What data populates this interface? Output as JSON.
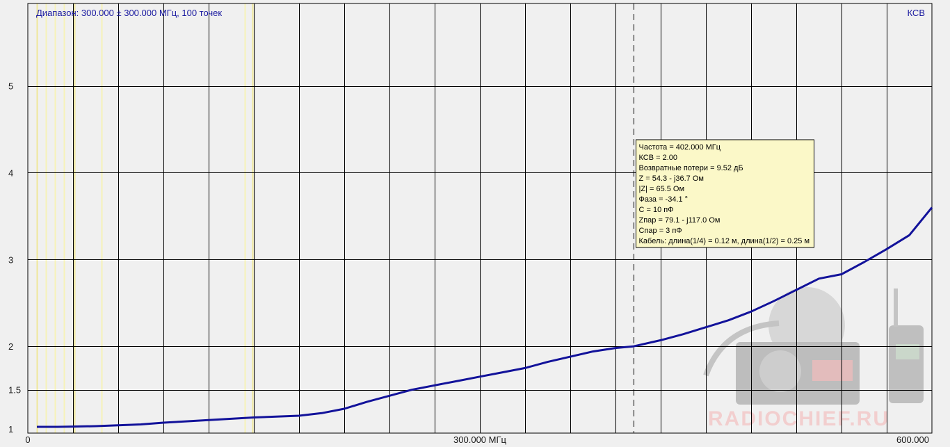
{
  "chart_data": {
    "type": "line",
    "title": "Диапазон: 300.000 ± 300.000 МГц, 100 точек",
    "legend": "КСВ",
    "legend_position": "top-right",
    "x_ticks": [
      {
        "value": 0,
        "label": "0"
      },
      {
        "value": 300,
        "label": "300.000 МГц"
      },
      {
        "value": 600,
        "label": "600.000"
      }
    ],
    "y_ticks": [
      {
        "value": 1,
        "label": "1"
      },
      {
        "value": 1.5,
        "label": "1.5"
      },
      {
        "value": 2,
        "label": "2"
      },
      {
        "value": 3,
        "label": "3"
      },
      {
        "value": 4,
        "label": "4"
      },
      {
        "value": 5,
        "label": "5"
      }
    ],
    "xlim": [
      0,
      600
    ],
    "ylim": [
      1,
      5.95
    ],
    "grid": true,
    "vertical_gridlines": [
      30,
      60,
      90,
      120,
      150,
      180,
      210,
      240,
      270,
      300,
      330,
      360,
      390,
      420,
      450,
      480,
      510,
      540,
      570
    ],
    "highlight_lines": [
      6,
      12,
      18,
      24,
      31,
      49,
      144,
      149
    ],
    "series": [
      {
        "color": "#12129a",
        "points": [
          [
            6,
            1.072
          ],
          [
            20,
            1.072
          ],
          [
            30,
            1.075
          ],
          [
            45,
            1.08
          ],
          [
            60,
            1.09
          ],
          [
            75,
            1.1
          ],
          [
            90,
            1.12
          ],
          [
            105,
            1.135
          ],
          [
            120,
            1.15
          ],
          [
            135,
            1.165
          ],
          [
            150,
            1.18
          ],
          [
            165,
            1.19
          ],
          [
            180,
            1.2
          ],
          [
            195,
            1.23
          ],
          [
            210,
            1.28
          ],
          [
            225,
            1.36
          ],
          [
            240,
            1.43
          ],
          [
            255,
            1.5
          ],
          [
            270,
            1.55
          ],
          [
            285,
            1.6
          ],
          [
            300,
            1.65
          ],
          [
            315,
            1.7
          ],
          [
            330,
            1.75
          ],
          [
            345,
            1.82
          ],
          [
            360,
            1.88
          ],
          [
            375,
            1.94
          ],
          [
            390,
            1.98
          ],
          [
            402,
            2.0
          ],
          [
            420,
            2.07
          ],
          [
            435,
            2.14
          ],
          [
            450,
            2.22
          ],
          [
            465,
            2.3
          ],
          [
            480,
            2.4
          ],
          [
            495,
            2.52
          ],
          [
            510,
            2.65
          ],
          [
            525,
            2.78
          ],
          [
            540,
            2.83
          ],
          [
            555,
            2.97
          ],
          [
            570,
            3.12
          ],
          [
            585,
            3.28
          ],
          [
            600,
            3.6
          ]
        ]
      }
    ],
    "marker": {
      "x": 402,
      "readout": [
        "Частота = 402.000 МГц",
        "КСВ = 2.00",
        "Возвратные потери = 9.52 дБ",
        "Z = 54.3 - j36.7 Ом",
        "|Z| = 65.5 Ом",
        "Фаза = -34.1 °",
        "C = 10 пФ",
        "Zпар = 79.1 - j117.0 Ом",
        "Cпар = 3 пФ",
        "Кабель: длина(1/4) = 0.12 м, длина(1/2) = 0.25 м"
      ]
    },
    "watermark": "RADIOCHIEF.RU",
    "watermark_color": "#f3c9c9",
    "axis_color": "#000000",
    "title_color": "#1a1aa0"
  }
}
